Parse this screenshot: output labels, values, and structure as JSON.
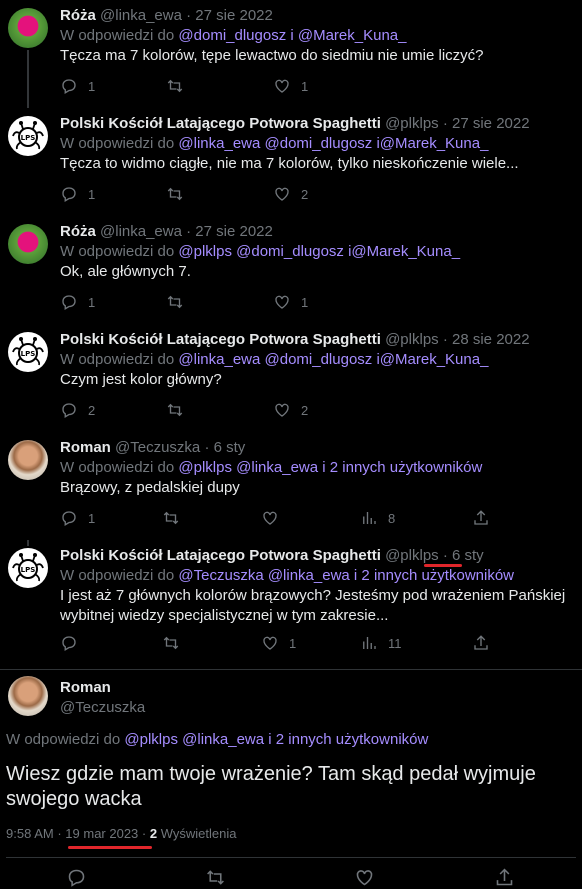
{
  "tweets": [
    {
      "name": "Róża",
      "handle": "@linka_ewa",
      "sep": "·",
      "date": "27 sie 2022",
      "reply_prefix": "W odpowiedzi do",
      "reply_mentions": "@domi_dlugosz i @Marek_Kuna_",
      "text": "Tęcza ma 7 kolorów, tępe lewactwo do siedmiu nie umie liczyć?",
      "replies": "1",
      "retweets": "",
      "likes": "1",
      "views": ""
    },
    {
      "name": "Polski Kościół Latającego Potwora Spaghetti",
      "handle": "@plklps",
      "sep": "·",
      "date": "27 sie 2022",
      "reply_prefix": "W odpowiedzi do",
      "reply_mentions": "@linka_ewa @domi_dlugosz i@Marek_Kuna_",
      "text": "Tęcza to widmo ciągłe, nie ma 7 kolorów, tylko nieskończenie wiele...",
      "replies": "1",
      "retweets": "",
      "likes": "2",
      "views": ""
    },
    {
      "name": "Róża",
      "handle": "@linka_ewa",
      "sep": "·",
      "date": "27 sie 2022",
      "reply_prefix": "W odpowiedzi do",
      "reply_mentions": "@plklps @domi_dlugosz i@Marek_Kuna_",
      "text": "Ok, ale głównych 7.",
      "replies": "1",
      "retweets": "",
      "likes": "1",
      "views": ""
    },
    {
      "name": "Polski Kościół Latającego Potwora Spaghetti",
      "handle": "@plklps",
      "sep": "·",
      "date": "28 sie 2022",
      "reply_prefix": "W odpowiedzi do",
      "reply_mentions": "@linka_ewa @domi_dlugosz i@Marek_Kuna_",
      "text": "Czym jest kolor główny?",
      "replies": "2",
      "retweets": "",
      "likes": "2",
      "views": ""
    },
    {
      "name": "Roman",
      "handle": "@Teczuszka",
      "sep": "·",
      "date": "6 sty",
      "reply_prefix": "W odpowiedzi do",
      "reply_mentions": "@plklps @linka_ewa  i 2 innych użytkowników",
      "text": "Brązowy, z pedalskiej dupy",
      "replies": "1",
      "retweets": "",
      "likes": "",
      "views": "8"
    },
    {
      "name": "Polski Kościół Latającego Potwora Spaghetti",
      "handle": "@plklps",
      "sep": "·",
      "date": "6 sty",
      "reply_prefix": "W odpowiedzi do",
      "reply_mentions": "@Teczuszka @linka_ewa  i 2 innych użytkowników",
      "text": "I jest aż 7 głównych kolorów brązowych? Jesteśmy pod wrażeniem Pańskiej wybitnej wiedzy specjalistycznej w tym zakresie...",
      "replies": "",
      "retweets": "",
      "likes": "1",
      "views": "11"
    }
  ],
  "main": {
    "name": "Roman",
    "handle": "@Teczuszka",
    "reply_prefix": "W odpowiedzi do",
    "reply_mentions": "@plklps @linka_ewa  i 2 innych użytkowników",
    "text": "Wiesz gdzie mam twoje wrażenie? Tam skąd pedał wyjmuje swojego wacka",
    "time": "9:58 AM",
    "sep": "·",
    "date": "19 mar 2023",
    "sep2": "·",
    "views_count": "2",
    "views_label": "Wyświetlenia"
  },
  "colors": {
    "background": "#000000",
    "mention": "#a58dff",
    "muted": "#71767b",
    "annotation": "#e0262b"
  }
}
